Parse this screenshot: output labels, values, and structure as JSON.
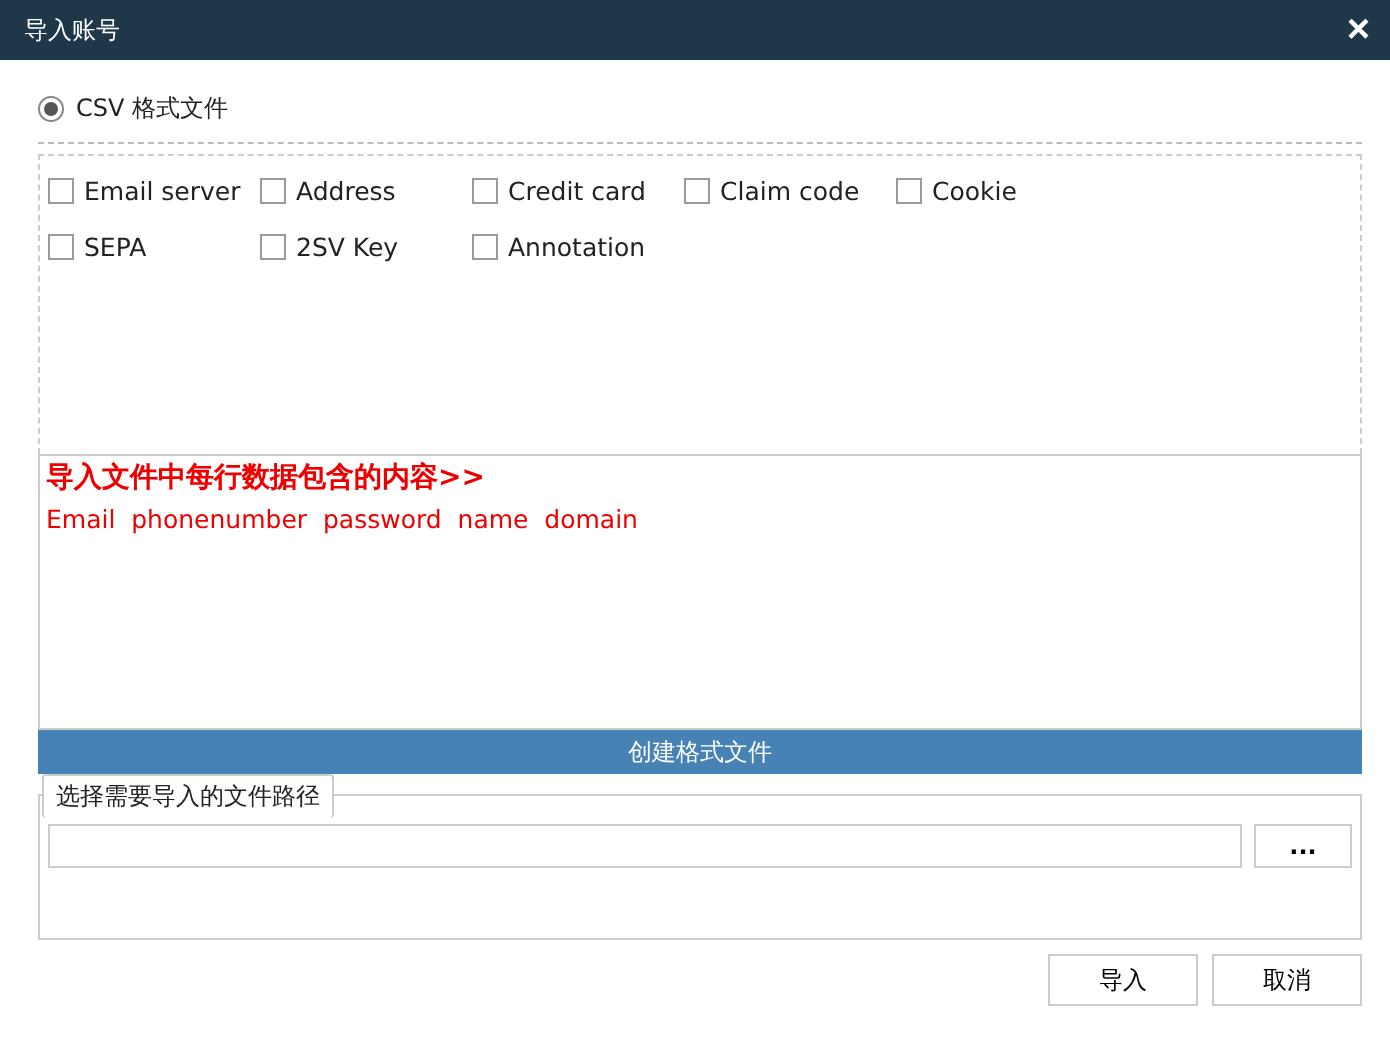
{
  "window": {
    "title": "导入账号",
    "close": "×"
  },
  "format_option": {
    "label": "CSV 格式文件",
    "selected": true
  },
  "fields": [
    {
      "label": "Email server",
      "checked": false
    },
    {
      "label": "Address",
      "checked": false
    },
    {
      "label": "Credit card",
      "checked": false
    },
    {
      "label": "Claim code",
      "checked": false
    },
    {
      "label": "Cookie",
      "checked": false
    },
    {
      "label": "SEPA",
      "checked": false
    },
    {
      "label": "2SV Key",
      "checked": false
    },
    {
      "label": "Annotation",
      "checked": false
    }
  ],
  "info": {
    "heading": "导入文件中每行数据包含的内容>>",
    "columns": "Email  phonenumber  password  name  domain"
  },
  "create_button": "创建格式文件",
  "file_group": {
    "legend": "选择需要导入的文件路径",
    "browse": "..."
  },
  "buttons": [
    "导入",
    "取消"
  ]
}
